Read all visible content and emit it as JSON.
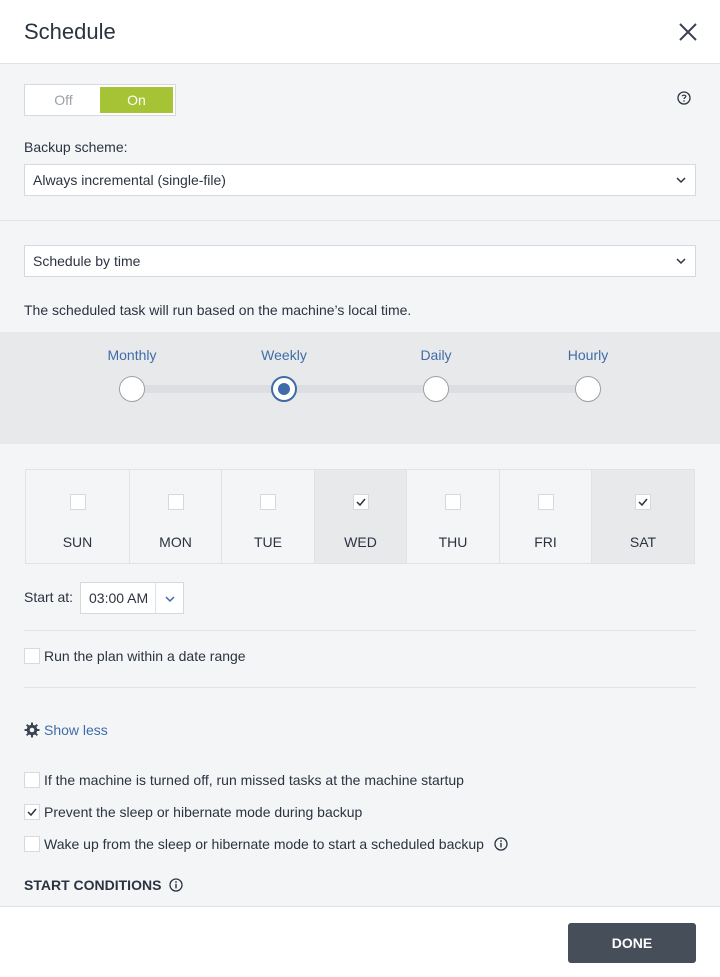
{
  "header": {
    "title": "Schedule",
    "close_icon": "close-icon"
  },
  "toggle": {
    "off_label": "Off",
    "on_label": "On",
    "state": "On",
    "on_color": "#a6c335"
  },
  "help_icon": "help-circle-icon",
  "backup_scheme": {
    "label": "Backup scheme:",
    "value": "Always incremental (single-file)"
  },
  "schedule_mode": {
    "value": "Schedule by time"
  },
  "local_time_note": "The scheduled task will run based on the machine’s local time.",
  "frequency": {
    "options": [
      "Monthly",
      "Weekly",
      "Daily",
      "Hourly"
    ],
    "selected": "Weekly",
    "accent_color": "#3f6ca8"
  },
  "days": [
    {
      "label": "SUN",
      "checked": false
    },
    {
      "label": "MON",
      "checked": false
    },
    {
      "label": "TUE",
      "checked": false
    },
    {
      "label": "WED",
      "checked": true
    },
    {
      "label": "THU",
      "checked": false
    },
    {
      "label": "FRI",
      "checked": false
    },
    {
      "label": "SAT",
      "checked": true
    }
  ],
  "start_at": {
    "label": "Start at:",
    "value": "03:00 AM"
  },
  "date_range": {
    "label": "Run the plan within a date range",
    "checked": false
  },
  "show_less": {
    "label": "Show less",
    "icon": "gear-icon"
  },
  "options": {
    "missed_tasks": {
      "label": "If the machine is turned off, run missed tasks at the machine startup",
      "checked": false
    },
    "prevent_sleep": {
      "label": "Prevent the sleep or hibernate mode during backup",
      "checked": true
    },
    "wake_up": {
      "label": "Wake up from the sleep or hibernate mode to start a scheduled backup",
      "checked": false,
      "info_icon": "info-icon"
    }
  },
  "start_conditions": {
    "heading": "START CONDITIONS",
    "info_icon": "info-icon"
  },
  "footer": {
    "done_label": "DONE"
  }
}
